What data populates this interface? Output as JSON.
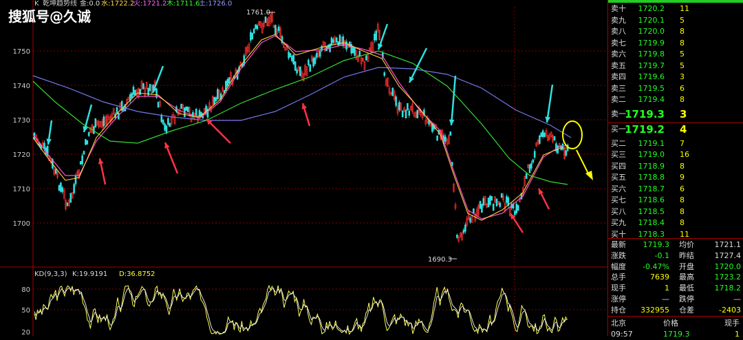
{
  "watermark": "搜狐号@久诚",
  "chart_header": {
    "symbol": "K",
    "indicator": "乾坤趋势线",
    "jin": "金:0.0",
    "shui": "水:1722.2",
    "huo": "火:1721.2",
    "mu": "木:1711.6",
    "tu": "土:1726.0"
  },
  "price_axis": [
    "1750",
    "1740",
    "1730",
    "1720",
    "1710",
    "1700"
  ],
  "kd_axis": [
    "80",
    "50",
    "20"
  ],
  "annotations": {
    "high": "1761.0",
    "low": "1690.3"
  },
  "kd_header": {
    "name": "KD(9,3,3)",
    "k": "K:19.9191",
    "d": "D:36.8752"
  },
  "colors": {
    "up": "#ff3030",
    "down": "#30e0e0",
    "accent_green": "#22ff22",
    "accent_yellow": "#ffff00"
  },
  "sell_orders": [
    {
      "label": "卖十",
      "price": "1720.2",
      "vol": "11"
    },
    {
      "label": "卖九",
      "price": "1720.1",
      "vol": "5"
    },
    {
      "label": "卖八",
      "price": "1720.0",
      "vol": "8"
    },
    {
      "label": "卖七",
      "price": "1719.9",
      "vol": "8"
    },
    {
      "label": "卖六",
      "price": "1719.8",
      "vol": "5"
    },
    {
      "label": "卖五",
      "price": "1719.7",
      "vol": "5"
    },
    {
      "label": "卖四",
      "price": "1719.6",
      "vol": "3"
    },
    {
      "label": "卖三",
      "price": "1719.5",
      "vol": "6"
    },
    {
      "label": "卖二",
      "price": "1719.4",
      "vol": "8"
    },
    {
      "label": "卖一",
      "price": "1719.3",
      "vol": "3"
    }
  ],
  "buy_orders": [
    {
      "label": "买一",
      "price": "1719.2",
      "vol": "4"
    },
    {
      "label": "买二",
      "price": "1719.1",
      "vol": "7"
    },
    {
      "label": "买三",
      "price": "1719.0",
      "vol": "16"
    },
    {
      "label": "买四",
      "price": "1718.9",
      "vol": "8"
    },
    {
      "label": "买五",
      "price": "1718.8",
      "vol": "9"
    },
    {
      "label": "买六",
      "price": "1718.7",
      "vol": "6"
    },
    {
      "label": "买七",
      "price": "1718.6",
      "vol": "8"
    },
    {
      "label": "买八",
      "price": "1718.5",
      "vol": "8"
    },
    {
      "label": "买九",
      "price": "1718.4",
      "vol": "8"
    },
    {
      "label": "买十",
      "price": "1718.3",
      "vol": "11"
    }
  ],
  "quotes": [
    {
      "l1": "最新",
      "v1": "1719.3",
      "c1": "green",
      "l2": "均价",
      "v2": "1721.1",
      "c2": "white"
    },
    {
      "l1": "涨跌",
      "v1": "-0.1",
      "c1": "green",
      "l2": "昨结",
      "v2": "1727.4",
      "c2": "white"
    },
    {
      "l1": "幅度",
      "v1": "-0.47%",
      "c1": "green",
      "l2": "开盘",
      "v2": "1720.0",
      "c2": "green"
    },
    {
      "l1": "总手",
      "v1": "7639",
      "c1": "yellow",
      "l2": "最高",
      "v2": "1723.2",
      "c2": "green"
    },
    {
      "l1": "现手",
      "v1": "1",
      "c1": "yellow",
      "l2": "最低",
      "v2": "1718.2",
      "c2": "green"
    },
    {
      "l1": "涨停",
      "v1": "—",
      "c1": "white",
      "l2": "跌停",
      "v2": "—",
      "c2": "white"
    },
    {
      "l1": "持仓",
      "v1": "332955",
      "c1": "yellow",
      "l2": "仓差",
      "v2": "-2403",
      "c2": "yellow"
    }
  ],
  "ticks": {
    "headers": [
      "北京",
      "价格",
      "现手"
    ],
    "row": [
      "09:57",
      "1719.3",
      "1"
    ]
  }
}
